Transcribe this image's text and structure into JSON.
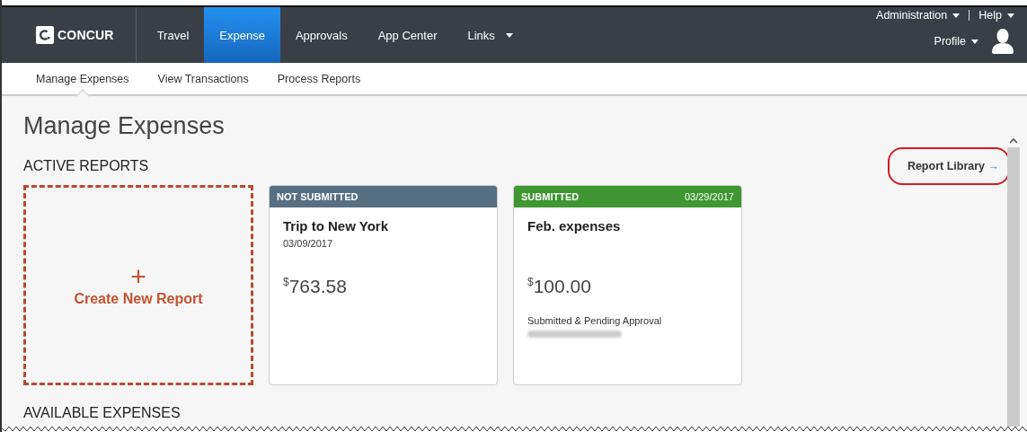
{
  "logo": {
    "text": "CONCUR"
  },
  "nav": [
    {
      "label": "Travel",
      "selected": false,
      "dropdown": false
    },
    {
      "label": "Expense",
      "selected": true,
      "dropdown": false
    },
    {
      "label": "Approvals",
      "selected": false,
      "dropdown": false
    },
    {
      "label": "App Center",
      "selected": false,
      "dropdown": false
    },
    {
      "label": "Links",
      "selected": false,
      "dropdown": true
    }
  ],
  "utility_links": [
    "Administration",
    "Help"
  ],
  "profile": {
    "label": "Profile"
  },
  "subnav": [
    {
      "label": "Manage Expenses",
      "selected": true
    },
    {
      "label": "View Transactions",
      "selected": false
    },
    {
      "label": "Process Reports",
      "selected": false
    }
  ],
  "page_title": "Manage Expenses",
  "section_title": "ACTIVE REPORTS",
  "report_library": {
    "label": "Report Library",
    "arrow": "→",
    "highlighted": true
  },
  "create_report": {
    "icon": "+",
    "label": "Create New Report"
  },
  "reports": [
    {
      "status": "NOT SUBMITTED",
      "color": "#566f83",
      "name": "Trip to New York",
      "date": "03/09/2017",
      "currency": "$",
      "amount": "763.58",
      "approver_blurred": false
    },
    {
      "status": "SUBMITTED",
      "color": "#3f9632",
      "status_date": "03/29/2017",
      "name": "Feb. expenses",
      "currency": "$",
      "amount": "100.00",
      "note": "Submitted & Pending Approval",
      "approver_blurred": true
    }
  ],
  "next_section_title": "AVAILABLE EXPENSES"
}
